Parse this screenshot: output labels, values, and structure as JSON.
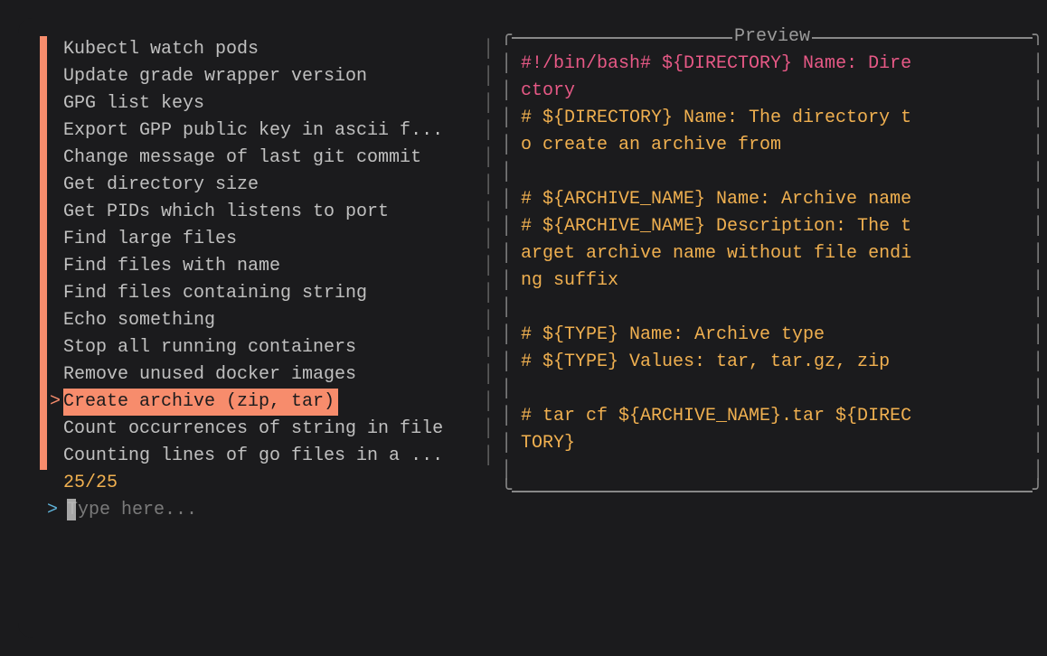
{
  "list": {
    "items": [
      {
        "label": "Kubectl watch pods",
        "marked": true,
        "selected": false
      },
      {
        "label": "Update grade wrapper version",
        "marked": true,
        "selected": false
      },
      {
        "label": "GPG list keys",
        "marked": true,
        "selected": false
      },
      {
        "label": "Export GPP public key in ascii f...",
        "marked": true,
        "selected": false
      },
      {
        "label": "Change message of last git commit",
        "marked": true,
        "selected": false
      },
      {
        "label": "Get directory size",
        "marked": true,
        "selected": false
      },
      {
        "label": "Get PIDs which listens to port",
        "marked": true,
        "selected": false
      },
      {
        "label": "Find large files",
        "marked": true,
        "selected": false
      },
      {
        "label": "Find files with name",
        "marked": true,
        "selected": false
      },
      {
        "label": "Find files containing string",
        "marked": true,
        "selected": false
      },
      {
        "label": "Echo something",
        "marked": true,
        "selected": false
      },
      {
        "label": "Stop all running containers",
        "marked": true,
        "selected": false
      },
      {
        "label": "Remove unused docker images",
        "marked": true,
        "selected": false
      },
      {
        "label": "Create archive (zip, tar)",
        "marked": true,
        "selected": true
      },
      {
        "label": "Count occurrences of string in file",
        "marked": true,
        "selected": false
      },
      {
        "label": "Counting lines of go files in a ...",
        "marked": true,
        "selected": false
      }
    ],
    "counter": "25/25"
  },
  "prompt": {
    "symbol": ">",
    "placeholder": "Type here..."
  },
  "preview": {
    "title": "Preview",
    "lines": [
      {
        "segments": [
          {
            "text": "#!/bin/bash# ",
            "cls": "pink"
          },
          {
            "text": "${DIRECTORY} Name: Dire",
            "cls": "pink"
          }
        ]
      },
      {
        "segments": [
          {
            "text": "ctory",
            "cls": "pink"
          }
        ]
      },
      {
        "segments": [
          {
            "text": "# ${DIRECTORY} Name: The directory t",
            "cls": "orange"
          }
        ]
      },
      {
        "segments": [
          {
            "text": "o create an archive from",
            "cls": "orange"
          }
        ]
      },
      {
        "segments": []
      },
      {
        "segments": [
          {
            "text": "# ${ARCHIVE_NAME} Name: Archive name",
            "cls": "orange"
          }
        ]
      },
      {
        "segments": [
          {
            "text": "# ${ARCHIVE_NAME} Description: The t",
            "cls": "orange"
          }
        ]
      },
      {
        "segments": [
          {
            "text": "arget archive name without file endi",
            "cls": "orange"
          }
        ]
      },
      {
        "segments": [
          {
            "text": "ng suffix",
            "cls": "orange"
          }
        ]
      },
      {
        "segments": []
      },
      {
        "segments": [
          {
            "text": "# ${TYPE} Name: Archive type",
            "cls": "orange"
          }
        ]
      },
      {
        "segments": [
          {
            "text": "# ${TYPE} Values: tar, tar.gz, zip",
            "cls": "orange"
          }
        ]
      },
      {
        "segments": []
      },
      {
        "segments": [
          {
            "text": "# tar cf ${ARCHIVE_NAME}.tar ${DIREC",
            "cls": "orange"
          }
        ]
      },
      {
        "segments": [
          {
            "text": "TORY}",
            "cls": "orange"
          }
        ]
      },
      {
        "segments": []
      }
    ]
  },
  "pointer": ">"
}
